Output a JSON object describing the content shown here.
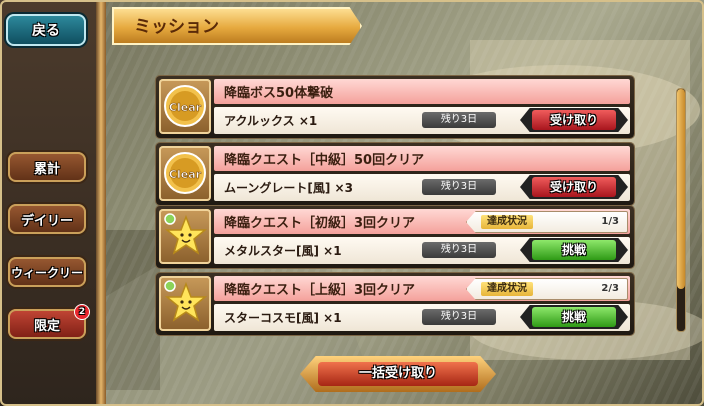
{
  "header": {
    "title": "ミッション"
  },
  "sidebar": {
    "back_label": "戻る",
    "items": [
      {
        "label": "累計"
      },
      {
        "label": "デイリー"
      },
      {
        "label": "ウィークリー"
      },
      {
        "label": "限定",
        "badge": "2"
      }
    ]
  },
  "missions": [
    {
      "title": "降臨ボス50体撃破",
      "reward": "アクルックス ×1",
      "remaining": "残り3日",
      "status_icon": "clear-icon",
      "icon_text": "Clear",
      "action": "受け取り"
    },
    {
      "title": "降臨クエスト［中級］50回クリア",
      "reward": "ムーングレート[風] ×3",
      "remaining": "残り3日",
      "status_icon": "clear-icon",
      "icon_text": "Clear",
      "action": "受け取り"
    },
    {
      "title": "降臨クエスト［初級］3回クリア",
      "reward": "メタルスター[風] ×1",
      "remaining": "残り3日",
      "status_icon": "star-icon",
      "progress_label": "達成状況",
      "progress": "1/3",
      "action": "挑戦"
    },
    {
      "title": "降臨クエスト［上級］3回クリア",
      "reward": "スターコスモ[風] ×1",
      "remaining": "残り3日",
      "status_icon": "star-icon",
      "progress_label": "達成状況",
      "progress": "2/3",
      "action": "挑戦"
    }
  ],
  "footer": {
    "bulk_receive_label": "一括受け取り"
  },
  "colors": {
    "receive": "#c9262c",
    "challenge": "#43b21f",
    "title_ribbon": "#e6a93e"
  }
}
